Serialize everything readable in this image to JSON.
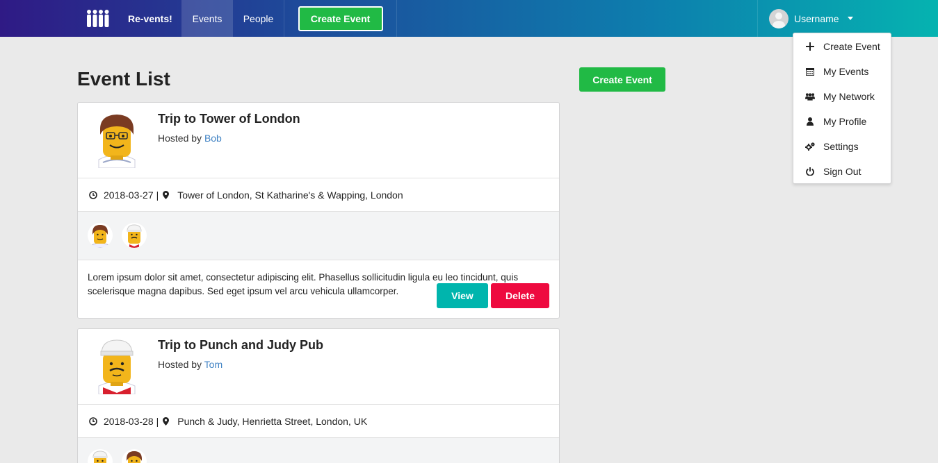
{
  "brand": {
    "name": "Re-vents!",
    "logo_icon": "people-group-logo-icon"
  },
  "nav": {
    "events": "Events",
    "people": "People",
    "create_event": "Create Event",
    "username": "Username"
  },
  "user_menu": {
    "items": [
      {
        "label": "Create Event",
        "icon": "plus-icon"
      },
      {
        "label": "My Events",
        "icon": "calendar-icon"
      },
      {
        "label": "My Network",
        "icon": "users-icon"
      },
      {
        "label": "My Profile",
        "icon": "user-icon"
      },
      {
        "label": "Settings",
        "icon": "settings-icon"
      },
      {
        "label": "Sign Out",
        "icon": "power-icon"
      }
    ]
  },
  "page": {
    "title": "Event List",
    "create_button": "Create Event"
  },
  "events": [
    {
      "title": "Trip to Tower of London",
      "hosted_by_prefix": "Hosted by",
      "host": "Bob",
      "date": "2018-03-27",
      "separator": "|",
      "venue": "Tower of London, St Katharine's & Wapping, London",
      "description": "Lorem ipsum dolor sit amet, consectetur adipiscing elit. Phasellus sollicitudin ligula eu leo tincidunt, quis scelerisque magna dapibus. Sed eget ipsum vel arcu vehicula ullamcorper.",
      "view_label": "View",
      "delete_label": "Delete"
    },
    {
      "title": "Trip to Punch and Judy Pub",
      "hosted_by_prefix": "Hosted by",
      "host": "Tom",
      "date": "2018-03-28",
      "separator": "|",
      "venue": "Punch & Judy, Henrietta Street, London, UK"
    }
  ],
  "colors": {
    "nav_gradient_start": "#2f1a85",
    "nav_gradient_end": "#05b3b0",
    "green": "#21ba45",
    "teal": "#00b5ad",
    "red": "#ee0a3f",
    "link": "#4183c4"
  }
}
